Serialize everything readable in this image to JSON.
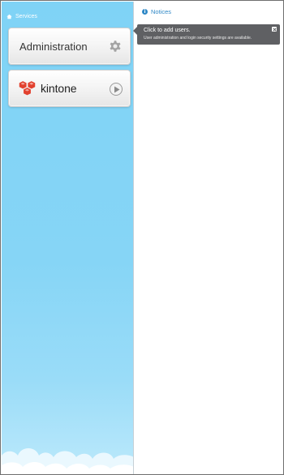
{
  "sidebar": {
    "header_label": "Services",
    "header_icon": "home-icon",
    "services": [
      {
        "label": "Administration",
        "icon": "gear-icon"
      },
      {
        "label": "kintone",
        "logo": "kintone-logo-icon",
        "icon": "play-icon"
      }
    ]
  },
  "notices": {
    "header_label": "Notices",
    "header_icon": "info-icon",
    "tooltip": {
      "title": "Click to add users.",
      "text": "User administration and login security settings are available.",
      "close_icon": "close-icon"
    }
  },
  "colors": {
    "sidebar_blue": "#86d5f6",
    "accent_blue": "#2f88c6",
    "tooltip_bg": "#5f6063",
    "kintone_red": "#e2412e"
  }
}
